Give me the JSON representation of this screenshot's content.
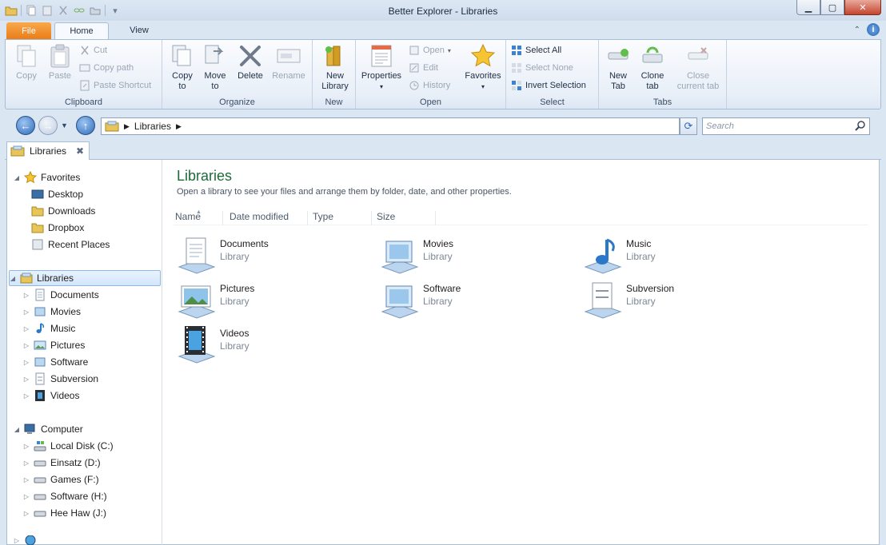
{
  "window": {
    "title": "Better Explorer - Libraries"
  },
  "ribbon_tabs": {
    "file": "File",
    "home": "Home",
    "view": "View"
  },
  "ribbon": {
    "clipboard": {
      "label": "Clipboard",
      "copy": "Copy",
      "paste": "Paste",
      "cut": "Cut",
      "copy_path": "Copy path",
      "paste_shortcut": "Paste Shortcut"
    },
    "organize": {
      "label": "Organize",
      "copy_to_1": "Copy",
      "copy_to_2": "to",
      "move_to_1": "Move",
      "move_to_2": "to",
      "delete": "Delete",
      "rename": "Rename"
    },
    "new": {
      "label": "New",
      "new_library_1": "New",
      "new_library_2": "Library"
    },
    "open": {
      "label": "Open",
      "properties": "Properties",
      "open": "Open",
      "edit": "Edit",
      "history": "History",
      "favorites": "Favorites"
    },
    "select": {
      "label": "Select",
      "select_all": "Select All",
      "select_none": "Select None",
      "invert_selection": "Invert Selection"
    },
    "tabs": {
      "label": "Tabs",
      "new_tab_1": "New",
      "new_tab_2": "Tab",
      "clone_tab_1": "Clone",
      "clone_tab_2": "tab",
      "close_tab_1": "Close",
      "close_tab_2": "current tab"
    }
  },
  "address": {
    "crumb": "Libraries",
    "search_placeholder": "Search"
  },
  "browser_tab": {
    "label": "Libraries"
  },
  "nav": {
    "favorites": "Favorites",
    "fav_items": [
      "Desktop",
      "Downloads",
      "Dropbox",
      "Recent Places"
    ],
    "libraries": "Libraries",
    "lib_items": [
      "Documents",
      "Movies",
      "Music",
      "Pictures",
      "Software",
      "Subversion",
      "Videos"
    ],
    "computer": "Computer",
    "drives": [
      "Local Disk (C:)",
      "Einsatz (D:)",
      "Games (F:)",
      "Software (H:)",
      "Hee Haw (J:)"
    ]
  },
  "main": {
    "title": "Libraries",
    "subtitle": "Open a library to see your files and arrange them by folder, date, and other properties.",
    "columns": [
      "Name",
      "Date modified",
      "Type",
      "Size"
    ],
    "items": [
      {
        "name": "Documents",
        "type": "Library"
      },
      {
        "name": "Movies",
        "type": "Library"
      },
      {
        "name": "Music",
        "type": "Library"
      },
      {
        "name": "Pictures",
        "type": "Library"
      },
      {
        "name": "Software",
        "type": "Library"
      },
      {
        "name": "Subversion",
        "type": "Library"
      },
      {
        "name": "Videos",
        "type": "Library"
      }
    ]
  },
  "colors": {
    "accent_green": "#1e6b3a",
    "file_tab": "#ea7a16",
    "close_button": "#c5452e"
  }
}
